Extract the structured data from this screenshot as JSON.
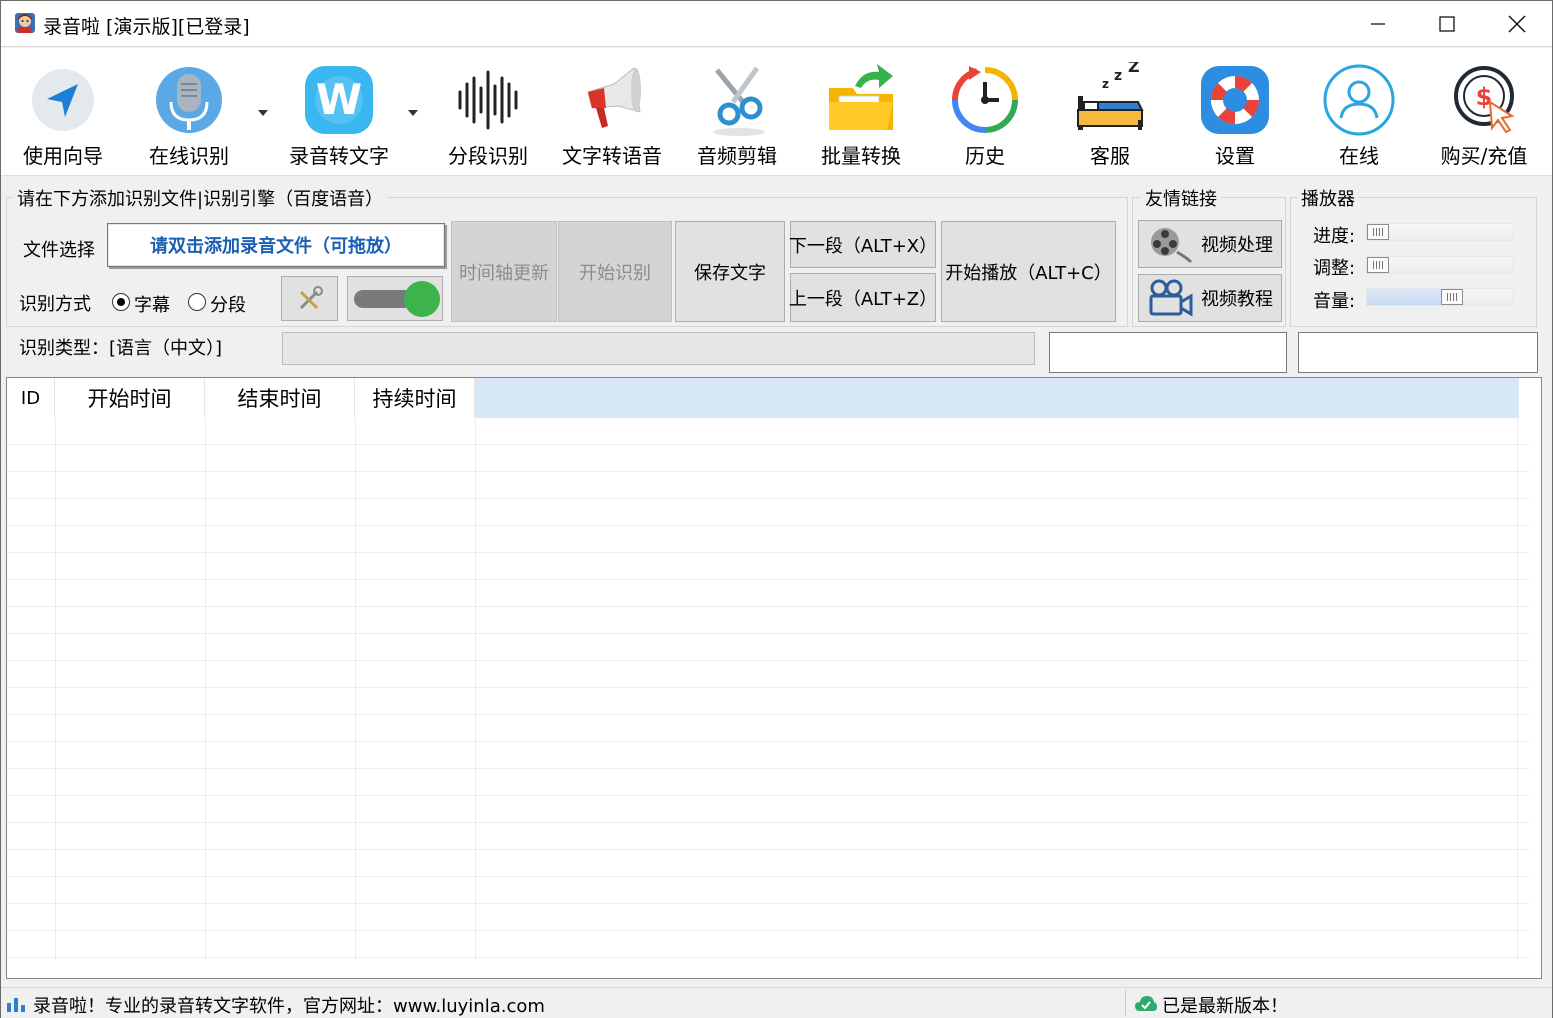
{
  "window": {
    "title": "录音啦 [演示版][已登录]",
    "controls": [
      "minimize",
      "maximize",
      "close"
    ]
  },
  "toolbar": {
    "items": [
      {
        "label": "使用向导",
        "icon": "navigation-arrow-icon"
      },
      {
        "label": "在线识别",
        "icon": "microphone-icon"
      },
      {
        "label": "录音转文字",
        "icon": "w-letter-icon"
      },
      {
        "label": "分段识别",
        "icon": "waveform-icon"
      },
      {
        "label": "文字转语音",
        "icon": "megaphone-icon"
      },
      {
        "label": "音频剪辑",
        "icon": "scissors-icon"
      },
      {
        "label": "批量转换",
        "icon": "folder-icon"
      },
      {
        "label": "历史",
        "icon": "clock-history-icon"
      },
      {
        "label": "客服",
        "icon": "sleeping-bed-icon"
      },
      {
        "label": "设置",
        "icon": "lifebuoy-icon"
      },
      {
        "label": "在线",
        "icon": "user-circle-icon"
      },
      {
        "label": "购买/充值",
        "icon": "dollar-cursor-icon"
      }
    ]
  },
  "recognition": {
    "group_title": "请在下方添加识别文件|识别引擎（百度语音）",
    "file_select_label": "文件选择",
    "add_file_button": "请双击添加录音文件（可拖放）",
    "mode_label": "识别方式",
    "mode_options": [
      "字幕",
      "分段"
    ],
    "mode_selected": "字幕",
    "type_label": "识别类型：[语言（中文）]",
    "toggle_on": true,
    "buttons": {
      "timeline_update": "时间轴更新",
      "start_recognition": "开始识别",
      "save_text": "保存文字",
      "next_segment": "下一段（ALT+X）",
      "prev_segment": "上一段（ALT+Z）",
      "start_play": "开始播放（ALT+C）"
    }
  },
  "links": {
    "group_title": "友情链接",
    "video_processing": "视频处理",
    "video_tutorial": "视频教程"
  },
  "player": {
    "group_title": "播放器",
    "progress_label": "进度:",
    "adjust_label": "调整:",
    "volume_label": "音量:",
    "progress_value": 0,
    "adjust_value": 0,
    "volume_value": 0.6
  },
  "table": {
    "columns": [
      "ID",
      "开始时间",
      "结束时间",
      "持续时间"
    ],
    "rows": []
  },
  "status": {
    "left": "录音啦！专业的录音转文字软件，官方网址：www.luyinla.com",
    "right": "已是最新版本！"
  }
}
